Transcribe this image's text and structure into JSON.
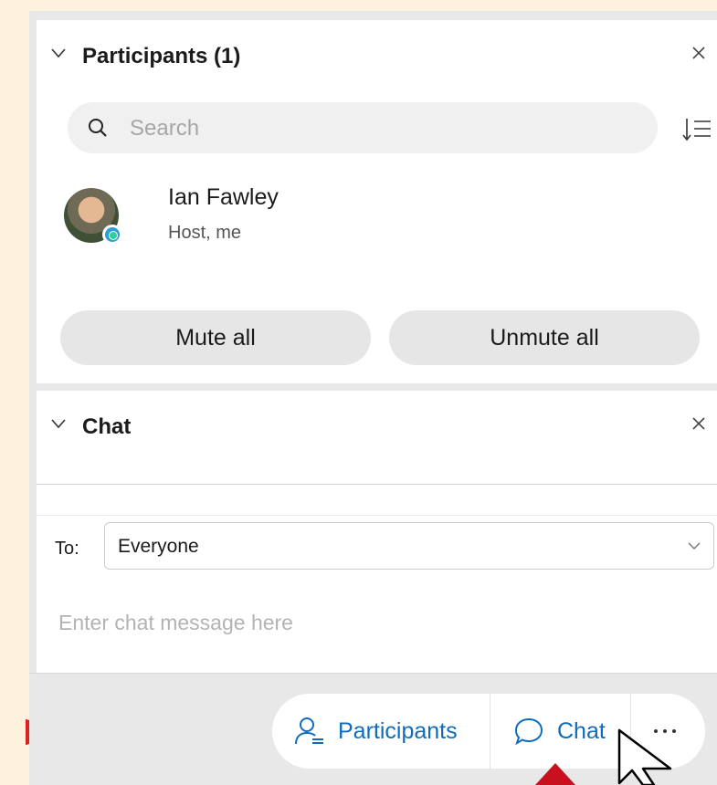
{
  "participants": {
    "title": "Participants (1)",
    "search_placeholder": "Search",
    "list": [
      {
        "name": "Ian Fawley",
        "role": "Host, me"
      }
    ],
    "mute_all": "Mute all",
    "unmute_all": "Unmute all"
  },
  "chat": {
    "title": "Chat",
    "to_label": "To:",
    "to_value": "Everyone",
    "message_placeholder": "Enter chat message here"
  },
  "toolbar": {
    "participants_label": "Participants",
    "chat_label": "Chat",
    "more_label": "···"
  },
  "colors": {
    "accent": "#0f6cbd",
    "page_background": "#fdf2dd",
    "panel_background": "#e8e8e8",
    "indicator_red": "#c8101e"
  },
  "icons": [
    "chevron-down-icon",
    "close-icon",
    "search-icon",
    "sort-icon",
    "presence-icon",
    "participants-icon",
    "chat-bubble-icon",
    "more-icon",
    "mouse-pointer-icon"
  ]
}
